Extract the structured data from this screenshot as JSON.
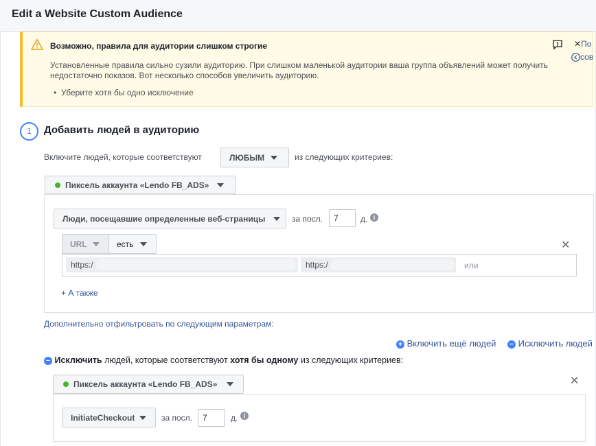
{
  "dialog": {
    "title": "Edit a Website Custom Audience"
  },
  "warning": {
    "title": "Возможно, правила для аудитории слишком строгие",
    "body": "Установленные правила сильно сузили аудиторию. При слишком маленькой аудитории ваша группа объявлений может получить недостаточно показов. Вот несколько способов увеличить аудиторию.",
    "bullet": "Уберите хотя бы одно исключение",
    "icon": "warning-icon",
    "color": "#f7b928"
  },
  "edge": {
    "link1": "По",
    "link2": "сов"
  },
  "include": {
    "step_number": "1",
    "title": "Добавить людей в аудиторию",
    "criteria_prefix": "Включите людей, которые соответствуют",
    "match_value": "ЛЮБЫМ",
    "criteria_suffix": "из следующих критериев:",
    "pixel_label": "Пиксель аккаунта «Lendo FB_ADS»",
    "rule_type": "Люди, посещавшие определенные веб-страницы",
    "period_prefix": "за посл.",
    "days_value": "7",
    "days_unit": "д.",
    "url_field": "URL",
    "operator": "есть",
    "url_tag_1": "https:/",
    "url_tag_2": "https:/",
    "or_label": "или",
    "also_label": "+ А также"
  },
  "filter_link": "Дополнительно отфильтровать по следующим параметрам:",
  "actions": {
    "include_more": "Включить ещё людей",
    "exclude": "Исключить людей"
  },
  "exclude": {
    "bold_prefix": "Исключить",
    "middle": " людей, которые соответствуют ",
    "bold_match": "хотя бы одному",
    "suffix": " из следующих критериев:",
    "pixel_label": "Пиксель аккаунта «Lendo FB_ADS»",
    "event": "InitiateCheckout",
    "period_prefix": "за посл.",
    "days_value": "7",
    "days_unit": "д."
  },
  "colors": {
    "accent": "#4080ff",
    "link": "#365899",
    "pixel_active": "#42b72a"
  }
}
